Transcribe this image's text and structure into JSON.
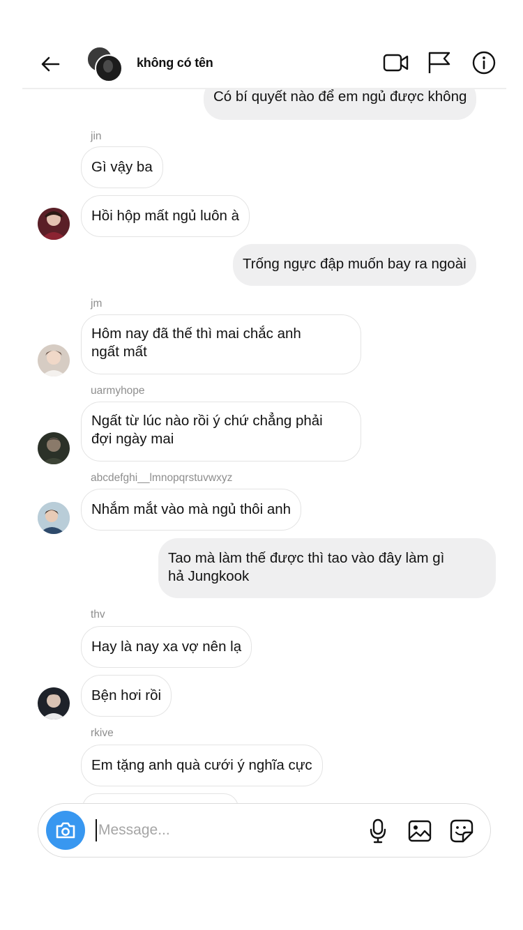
{
  "header": {
    "title": "không có tên"
  },
  "messages": [
    {
      "from": "me",
      "text": "Có bí quyết nào để em ngủ được không"
    },
    {
      "sender": "jin",
      "text": "Gì vậy ba"
    },
    {
      "sender": "jin",
      "text": "Hồi hộp mất ngủ luôn à"
    },
    {
      "from": "me",
      "text": "Trống ngực đập muốn bay ra ngoài"
    },
    {
      "sender": "jm",
      "line1": "Hôm nay đã thế thì mai chắc anh",
      "line2": "ngất mất"
    },
    {
      "sender": "uarmyhope",
      "line1": "Ngất từ lúc nào rồi ý chứ chẳng phải",
      "line2": "đợi ngày mai"
    },
    {
      "sender": "abcdefghi__lmnopqrstuvwxyz",
      "text": "Nhắm mắt vào mà ngủ thôi anh"
    },
    {
      "from": "me",
      "line1": "Tao mà làm thế được thì tao vào đây làm gì",
      "line2": "hả Jungkook"
    },
    {
      "sender": "thv",
      "text": "Hay là nay xa vợ nên lạ"
    },
    {
      "sender": "thv",
      "text": "Bện hơi rồi"
    },
    {
      "sender": "rkive",
      "text": "Em tặng anh quà cưới ý nghĩa cực"
    }
  ],
  "composer": {
    "placeholder": "Message..."
  },
  "icons": {
    "back": "arrow-left-icon",
    "video": "video-camera-icon",
    "report": "flag-icon",
    "info": "info-icon",
    "camera": "camera-icon",
    "mic": "microphone-icon",
    "gallery": "image-icon",
    "sticker": "sticker-icon"
  },
  "colors": {
    "accent": "#3897f0",
    "outgoing_bubble": "#efeff0",
    "incoming_border": "#e3e3e3",
    "sender_label": "#8e8e8e"
  }
}
